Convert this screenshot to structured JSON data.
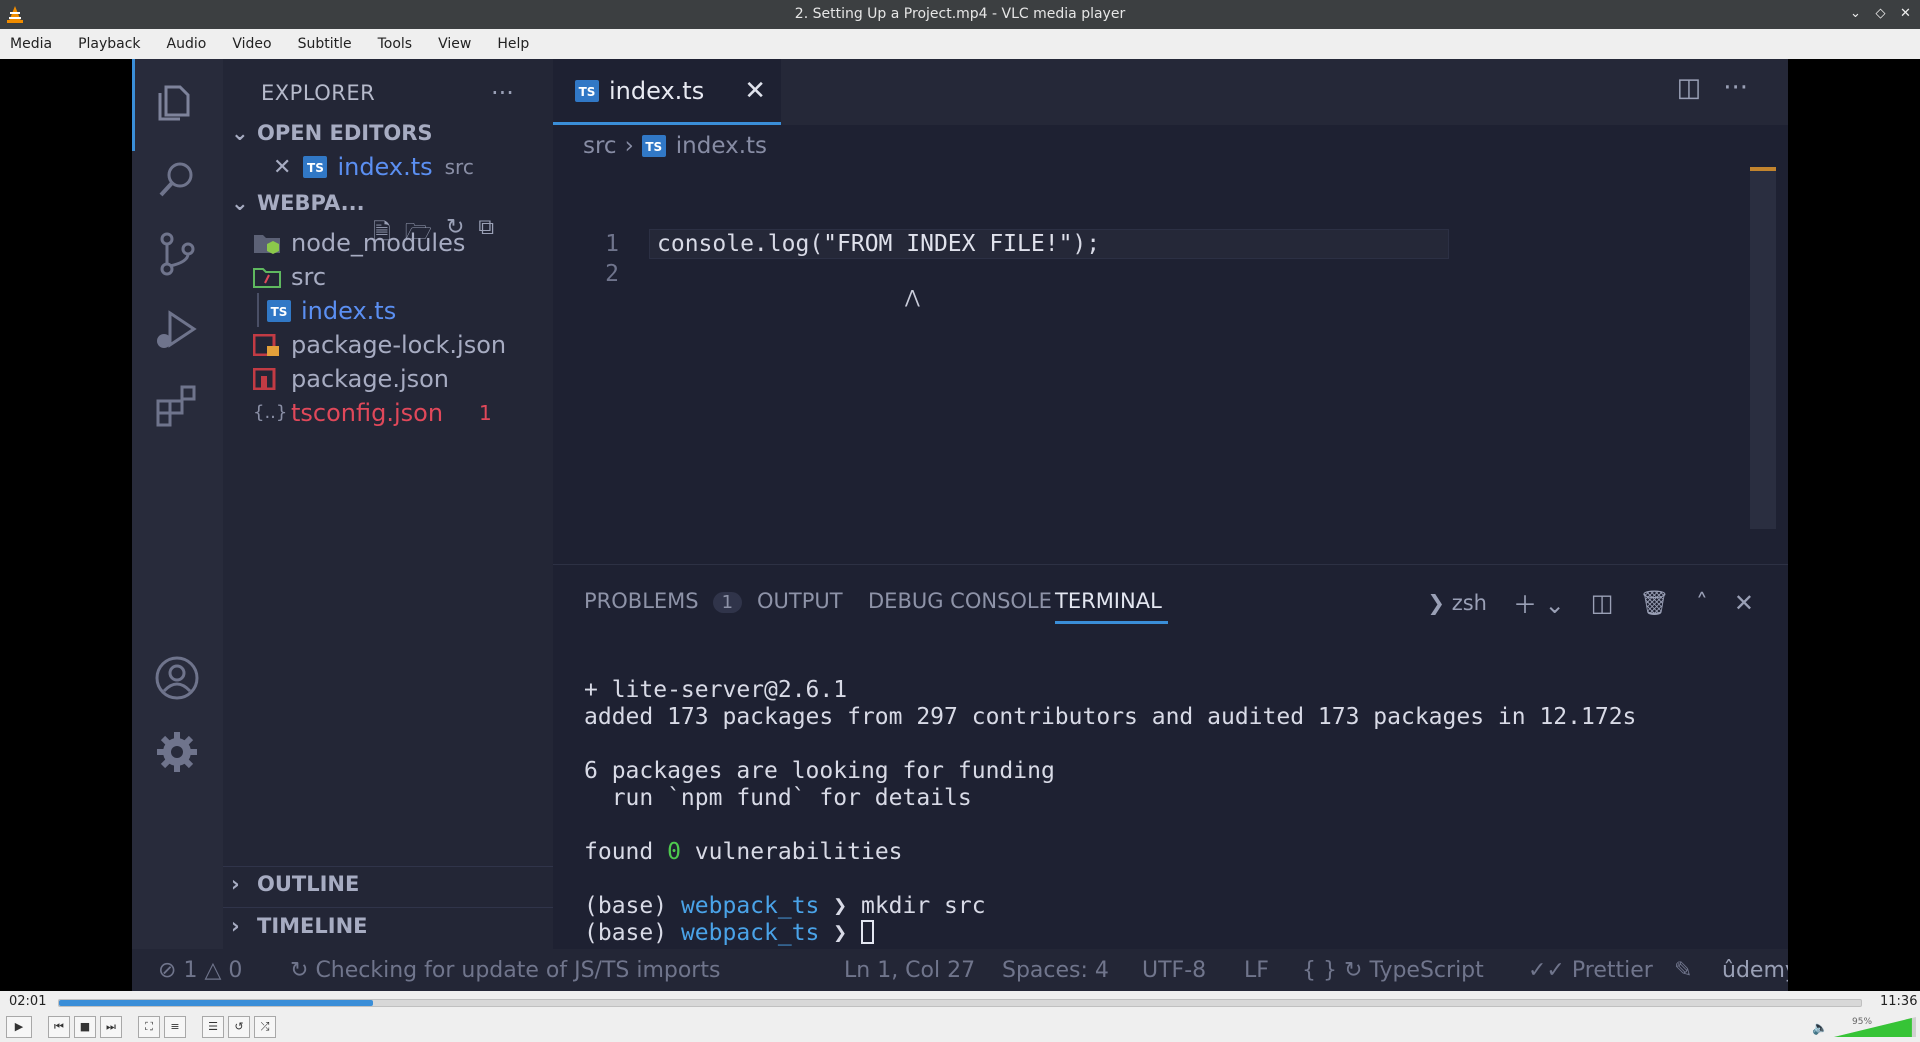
{
  "window": {
    "title": "2. Setting Up a Project.mp4 - VLC media player"
  },
  "menu": [
    "Media",
    "Playback",
    "Audio",
    "Video",
    "Subtitle",
    "Tools",
    "View",
    "Help"
  ],
  "vscode": {
    "sidebar": {
      "header": "EXPLORER",
      "open_editors_label": "OPEN EDITORS",
      "open_editor_file": "index.ts",
      "open_editor_dir": "src",
      "workspace_label": "WEBPA...",
      "tree": [
        {
          "name": "node_modules",
          "icon": "node-modules-folder-icon",
          "color": "#a7acc2"
        },
        {
          "name": "src",
          "icon": "src-folder-icon",
          "color": "#a7acc2"
        },
        {
          "name": "index.ts",
          "icon": "typescript-file-icon",
          "color": "#5b8ff2"
        },
        {
          "name": "package-lock.json",
          "icon": "npm-lock-icon",
          "color": "#a7acc2"
        },
        {
          "name": "package.json",
          "icon": "npm-icon",
          "color": "#a7acc2"
        },
        {
          "name": "tsconfig.json",
          "icon": "json-icon",
          "color": "#e0485a",
          "badge": "1"
        }
      ],
      "outline_label": "OUTLINE",
      "timeline_label": "TIMELINE"
    },
    "editor": {
      "tab_label": "index.ts",
      "ts_badge": "TS",
      "breadcrumb": {
        "folder": "src",
        "file": "index.ts"
      },
      "lines": [
        {
          "number": "1",
          "prefix": "console.log(",
          "string": "\"FROM INDEX FILE!\"",
          "suffix": ");"
        },
        {
          "number": "2",
          "prefix": "",
          "string": "",
          "suffix": ""
        }
      ]
    },
    "panel": {
      "tabs": {
        "problems": "PROBLEMS",
        "problems_count": "1",
        "output": "OUTPUT",
        "debug": "DEBUG CONSOLE",
        "terminal": "TERMINAL"
      },
      "shell": "zsh",
      "terminal": {
        "l1": "+ lite-server@2.6.1",
        "l2": "added 173 packages from 297 contributors and audited 173 packages in 12.172s",
        "l3": "6 packages are looking for funding",
        "l4": "  run `npm fund` for details",
        "l5a": "found ",
        "l5b": "0",
        "l5c": " vulnerabilities",
        "prompt_base": "(base) ",
        "prompt_dir": "webpack_ts",
        "prompt_arrow": " ❯ ",
        "cmd": "mkdir src"
      }
    },
    "status": {
      "errors": "1",
      "warnings": "0",
      "message": "Checking for update of JS/TS imports",
      "position": "Ln 1, Col 27",
      "spaces": "Spaces: 4",
      "encoding": "UTF-8",
      "eol": "LF",
      "language": "TypeScript",
      "formatter": "Prettier",
      "watermark": "ûdemy"
    }
  },
  "player": {
    "elapsed": "02:01",
    "total": "11:36",
    "progress_fraction": 0.174,
    "volume_label": "95%",
    "volume_fraction": 0.95
  }
}
